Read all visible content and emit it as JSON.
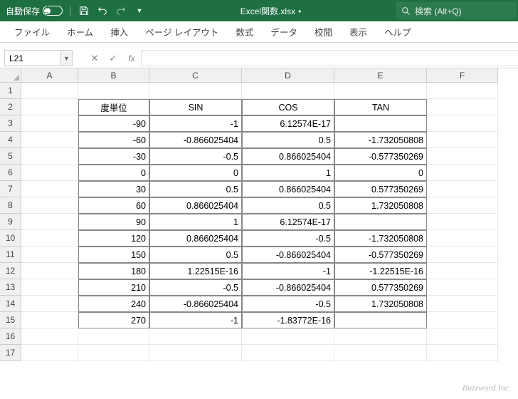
{
  "titlebar": {
    "autosave_label": "自動保存",
    "autosave_state": "オフ",
    "filename": "Excel関数.xlsx",
    "search_placeholder": "検索 (Alt+Q)"
  },
  "ribbon": {
    "tabs": [
      "ファイル",
      "ホーム",
      "挿入",
      "ページ レイアウト",
      "数式",
      "データ",
      "校閲",
      "表示",
      "ヘルプ"
    ]
  },
  "formula_bar": {
    "name_box": "L21",
    "formula": ""
  },
  "grid": {
    "col_headers": [
      "A",
      "B",
      "C",
      "D",
      "E",
      "F"
    ],
    "row_headers": [
      "1",
      "2",
      "3",
      "4",
      "5",
      "6",
      "7",
      "8",
      "9",
      "10",
      "11",
      "12",
      "13",
      "14",
      "15",
      "16",
      "17"
    ],
    "table": {
      "header": [
        "度単位",
        "SIN",
        "COS",
        "TAN"
      ],
      "rows": [
        {
          "deg": "-90",
          "sin": "-1",
          "cos": "6.12574E-17",
          "tan": ""
        },
        {
          "deg": "-60",
          "sin": "-0.866025404",
          "cos": "0.5",
          "tan": "-1.732050808"
        },
        {
          "deg": "-30",
          "sin": "-0.5",
          "cos": "0.866025404",
          "tan": "-0.577350269"
        },
        {
          "deg": "0",
          "sin": "0",
          "cos": "1",
          "tan": "0"
        },
        {
          "deg": "30",
          "sin": "0.5",
          "cos": "0.866025404",
          "tan": "0.577350269"
        },
        {
          "deg": "60",
          "sin": "0.866025404",
          "cos": "0.5",
          "tan": "1.732050808"
        },
        {
          "deg": "90",
          "sin": "1",
          "cos": "6.12574E-17",
          "tan": ""
        },
        {
          "deg": "120",
          "sin": "0.866025404",
          "cos": "-0.5",
          "tan": "-1.732050808"
        },
        {
          "deg": "150",
          "sin": "0.5",
          "cos": "-0.866025404",
          "tan": "-0.577350269"
        },
        {
          "deg": "180",
          "sin": "1.22515E-16",
          "cos": "-1",
          "tan": "-1.22515E-16"
        },
        {
          "deg": "210",
          "sin": "-0.5",
          "cos": "-0.866025404",
          "tan": "0.577350269"
        },
        {
          "deg": "240",
          "sin": "-0.866025404",
          "cos": "-0.5",
          "tan": "1.732050808"
        },
        {
          "deg": "270",
          "sin": "-1",
          "cos": "-1.83772E-16",
          "tan": ""
        }
      ]
    }
  },
  "watermark": "Buzzword Inc."
}
